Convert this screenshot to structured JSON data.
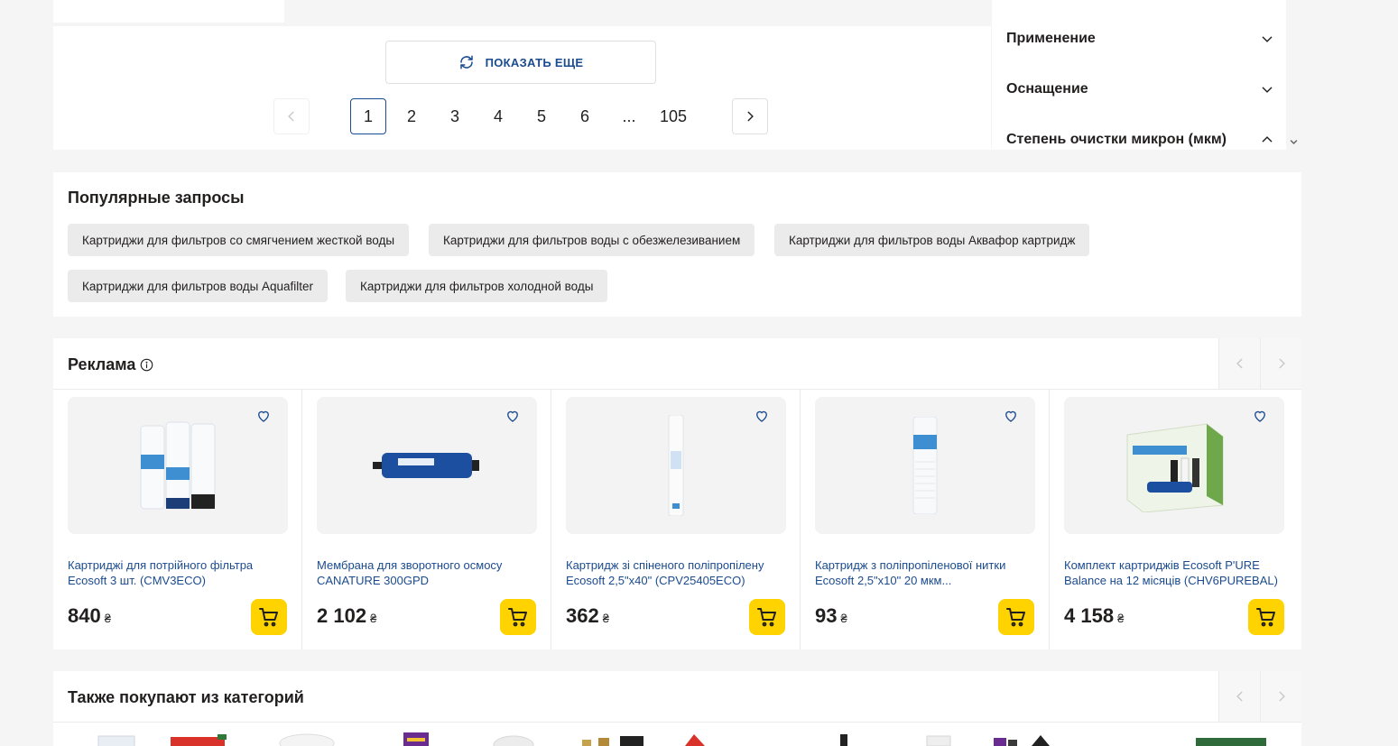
{
  "pagination": {
    "show_more_label": "ПОКАЗАТЬ ЕЩЕ",
    "pages": [
      "1",
      "2",
      "3",
      "4",
      "5",
      "6",
      "...",
      "105"
    ],
    "active_page": "1"
  },
  "filters": {
    "items": [
      {
        "label": "Применение",
        "state": "collapsed"
      },
      {
        "label": "Оснащение",
        "state": "collapsed"
      },
      {
        "label": "Степень очистки микрон (мкм)",
        "state": "expanded"
      }
    ]
  },
  "popular": {
    "title": "Популярные запросы",
    "chips": [
      "Картриджи для фильтров со смягчением жесткой воды",
      "Картриджи для фильтров воды с обезжелезиванием",
      "Картриджи для фильтров воды Аквафор картридж",
      "Картриджи для фильтров воды Aquafilter",
      "Картриджи для фильтров холодной воды"
    ]
  },
  "ads": {
    "title": "Реклама",
    "currency": "₴",
    "products": [
      {
        "title": "Картриджі для потрійного фільтра Ecosoft 3 шт. (CMV3ECO)",
        "price": "840",
        "image": "three-cartridges"
      },
      {
        "title": "Мембрана для зворотного осмосу CANATURE 300GPD",
        "price": "2 102",
        "image": "membrane"
      },
      {
        "title": "Картридж зі спіненого поліпропілену Ecosoft 2,5\"x40\" (CPV25405ECO)",
        "price": "362",
        "image": "long-cartridge"
      },
      {
        "title": "Картридж з поліпропіленової нитки Ecosoft 2,5\"x10\" 20 мкм...",
        "price": "93",
        "image": "string-cartridge"
      },
      {
        "title": "Комплект картриджів Ecosoft P'URE Balance на 12 місяців (CHV6PUREBAL)",
        "price": "4 158",
        "image": "box-kit"
      }
    ]
  },
  "also": {
    "title": "Также покупают из категорий"
  },
  "colors": {
    "link": "#1b4b8f",
    "cart": "#ffd300",
    "chip": "#ebebeb"
  }
}
